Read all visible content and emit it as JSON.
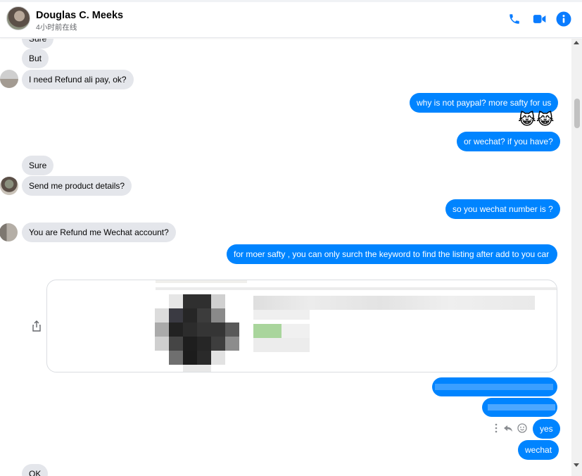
{
  "header": {
    "contact_name": "Douglas C. Meeks",
    "status": "4小时前在线",
    "icons": [
      "phone-icon",
      "video-icon",
      "info-icon"
    ]
  },
  "colors": {
    "accent": "#0084ff",
    "incoming_bubble": "#e4e6eb",
    "header_icon": "#0a7cff"
  },
  "messages": {
    "m0": "Sure",
    "m1": "But",
    "m2": "I need Refund ali pay, ok?",
    "m3": "why is not paypal? more safty for us",
    "m4": "😹😹",
    "m5": "or wechat? if you have?",
    "m6": "Sure",
    "m7": "Send me product details?",
    "m8": "so you wechat number is ?",
    "m9": "You are Refund me Wechat account?",
    "m10": "for moer safty , you can only surch the keyword to find the listing after add to you car",
    "m11": "yes",
    "m12": "wechat",
    "m13": "OK"
  }
}
